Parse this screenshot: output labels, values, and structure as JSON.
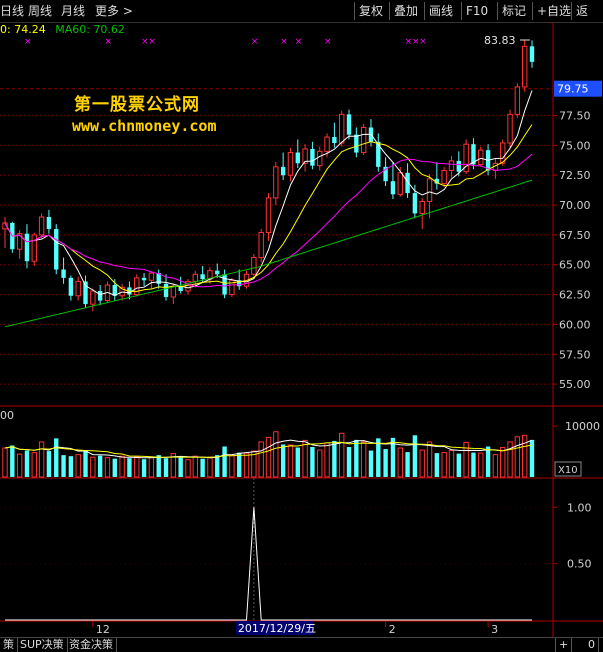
{
  "toolbar": {
    "left_tabs": [
      "日线",
      "周线",
      "月线",
      "更多 >"
    ],
    "right_buttons": [
      "复权",
      "叠加",
      "画线",
      "F10",
      "标记",
      "+自选",
      "返"
    ]
  },
  "ma_legend": {
    "ma_a": "0: 74.24",
    "ma60": "MA60: 70.62"
  },
  "price_panel": {
    "y_ticks": [
      "77.50",
      "75.00",
      "72.50",
      "70.00",
      "67.50",
      "65.00",
      "62.50",
      "60.00",
      "57.50",
      "55.00"
    ],
    "current_price": "79.75",
    "high_marker": "83.83"
  },
  "volume_panel": {
    "label": "00",
    "y_tick": "10000",
    "unit": "X10"
  },
  "indicator_panel": {
    "y_ticks": [
      "1.00",
      "0.50"
    ]
  },
  "x_axis": {
    "labels": [
      "12",
      "2017/12/29/五",
      "2",
      "3"
    ]
  },
  "watermark": {
    "line1": "第一股票公式网",
    "line2": "www.chnmoney.com"
  },
  "status_tabs": [
    "策",
    "SUP决策",
    "资金决策"
  ],
  "status_right": [
    "+",
    "0"
  ],
  "colors": {
    "up": "#ff3232",
    "down": "#54ffff",
    "ma_white": "#ffffff",
    "ma_yellow": "#ffff00",
    "ma_magenta": "#ff00ff",
    "ma_green": "#00c000",
    "grid": "#8b0000",
    "axis": "#b00000",
    "watermark": "#ffd200"
  },
  "chart_data": {
    "type": "candlestick",
    "price_ylim": [
      53.5,
      84.5
    ],
    "indicator_ylim": [
      0,
      1.1
    ],
    "candles": [
      [
        68.0,
        69.0,
        66.4,
        68.5
      ],
      [
        68.5,
        68.6,
        66.0,
        66.3
      ],
      [
        66.3,
        67.9,
        65.5,
        67.6
      ],
      [
        67.6,
        68.4,
        64.7,
        65.3
      ],
      [
        65.3,
        67.7,
        64.9,
        67.5
      ],
      [
        67.5,
        69.3,
        67.2,
        69.0
      ],
      [
        69.0,
        69.6,
        67.6,
        68.0
      ],
      [
        68.0,
        68.4,
        64.2,
        64.6
      ],
      [
        64.6,
        65.6,
        63.4,
        63.9
      ],
      [
        63.9,
        64.1,
        62.0,
        62.4
      ],
      [
        62.4,
        64.0,
        62.0,
        63.6
      ],
      [
        63.6,
        64.1,
        61.4,
        61.7
      ],
      [
        61.7,
        63.0,
        61.1,
        62.8
      ],
      [
        62.8,
        63.3,
        61.6,
        62.0
      ],
      [
        62.0,
        63.6,
        61.8,
        63.3
      ],
      [
        63.3,
        63.8,
        62.0,
        62.4
      ],
      [
        62.4,
        63.4,
        62.0,
        63.1
      ],
      [
        63.1,
        63.6,
        62.1,
        62.5
      ],
      [
        62.5,
        64.2,
        62.4,
        63.9
      ],
      [
        63.9,
        64.3,
        63.2,
        63.7
      ],
      [
        63.7,
        64.5,
        63.0,
        64.3
      ],
      [
        64.3,
        64.6,
        63.0,
        63.4
      ],
      [
        63.4,
        64.2,
        62.0,
        62.3
      ],
      [
        62.3,
        63.4,
        61.7,
        63.2
      ],
      [
        63.2,
        64.0,
        62.6,
        62.8
      ],
      [
        62.8,
        63.8,
        62.5,
        63.6
      ],
      [
        63.6,
        64.5,
        63.1,
        64.2
      ],
      [
        64.2,
        64.9,
        63.5,
        63.8
      ],
      [
        63.8,
        64.8,
        63.4,
        64.5
      ],
      [
        64.5,
        65.1,
        63.9,
        64.2
      ],
      [
        64.2,
        64.6,
        62.2,
        62.5
      ],
      [
        62.5,
        63.9,
        62.3,
        63.7
      ],
      [
        63.7,
        64.6,
        62.9,
        63.2
      ],
      [
        63.2,
        64.5,
        63.0,
        64.2
      ],
      [
        64.2,
        65.9,
        64.0,
        65.6
      ],
      [
        65.6,
        68.0,
        65.2,
        67.7
      ],
      [
        67.7,
        71.0,
        67.0,
        70.6
      ],
      [
        70.6,
        73.6,
        70.0,
        73.2
      ],
      [
        73.2,
        74.4,
        72.1,
        72.5
      ],
      [
        72.5,
        74.8,
        72.0,
        74.4
      ],
      [
        74.4,
        75.5,
        73.1,
        73.5
      ],
      [
        73.5,
        75.1,
        72.8,
        74.7
      ],
      [
        74.7,
        75.3,
        73.0,
        73.3
      ],
      [
        73.3,
        74.9,
        72.9,
        74.5
      ],
      [
        74.5,
        76.0,
        74.0,
        75.7
      ],
      [
        75.7,
        76.9,
        74.8,
        75.2
      ],
      [
        75.2,
        77.9,
        74.9,
        77.6
      ],
      [
        77.6,
        78.0,
        75.5,
        75.9
      ],
      [
        75.9,
        76.5,
        74.0,
        74.4
      ],
      [
        74.4,
        76.8,
        74.2,
        76.5
      ],
      [
        76.5,
        77.2,
        74.9,
        75.3
      ],
      [
        75.3,
        76.0,
        72.8,
        73.2
      ],
      [
        73.2,
        74.0,
        71.6,
        72.0
      ],
      [
        72.0,
        73.6,
        70.5,
        70.9
      ],
      [
        70.9,
        73.2,
        70.7,
        72.7
      ],
      [
        72.7,
        73.5,
        70.6,
        71.0
      ],
      [
        71.0,
        71.7,
        68.9,
        69.3
      ],
      [
        69.3,
        70.6,
        68.0,
        70.3
      ],
      [
        70.3,
        72.6,
        68.9,
        72.2
      ],
      [
        72.2,
        73.6,
        71.3,
        71.8
      ],
      [
        71.8,
        73.2,
        71.5,
        72.9
      ],
      [
        72.9,
        74.1,
        72.3,
        73.7
      ],
      [
        73.7,
        74.5,
        72.4,
        72.8
      ],
      [
        72.8,
        75.5,
        72.6,
        75.1
      ],
      [
        75.1,
        75.6,
        73.0,
        73.4
      ],
      [
        73.4,
        74.9,
        73.2,
        74.6
      ],
      [
        74.6,
        75.1,
        72.5,
        72.9
      ],
      [
        72.9,
        73.9,
        72.2,
        73.5
      ],
      [
        73.5,
        75.5,
        73.3,
        75.2
      ],
      [
        75.2,
        78.0,
        74.8,
        77.6
      ],
      [
        77.6,
        80.2,
        77.3,
        79.9
      ],
      [
        79.9,
        83.8,
        79.5,
        83.3
      ],
      [
        83.3,
        83.8,
        81.5,
        82.0
      ]
    ],
    "volume": [
      5700,
      6200,
      4500,
      5200,
      4800,
      6900,
      5100,
      7600,
      4300,
      4100,
      4400,
      5300,
      3900,
      4200,
      3800,
      3600,
      4100,
      3700,
      4000,
      3500,
      3800,
      4300,
      3700,
      4600,
      3900,
      3400,
      4100,
      3600,
      3900,
      4300,
      6000,
      4200,
      4800,
      4700,
      5100,
      6900,
      7800,
      8900,
      6400,
      6300,
      5800,
      7200,
      5900,
      5300,
      6700,
      7100,
      8600,
      5900,
      7300,
      6900,
      5200,
      7600,
      5500,
      7700,
      5700,
      4900,
      8200,
      5300,
      6900,
      4700,
      4800,
      5200,
      4600,
      6800,
      4800,
      4700,
      6000,
      4400,
      5800,
      6900,
      7900,
      8200,
      7300
    ],
    "indicator": [
      0,
      0,
      0,
      0,
      0,
      0,
      0,
      0,
      0,
      0,
      0,
      0,
      0,
      0,
      0,
      0,
      0,
      0,
      0,
      0,
      0,
      0,
      0,
      0,
      0,
      0,
      0,
      0,
      0,
      0,
      0,
      0,
      0,
      0,
      1.0,
      0,
      0,
      0,
      0,
      0,
      0,
      0,
      0,
      0,
      0,
      0,
      0,
      0,
      0,
      0,
      0,
      0,
      0,
      0,
      0,
      0,
      0,
      0,
      0,
      0,
      0,
      0,
      0,
      0,
      0,
      0,
      0,
      0,
      0,
      0,
      0,
      0,
      0
    ]
  }
}
